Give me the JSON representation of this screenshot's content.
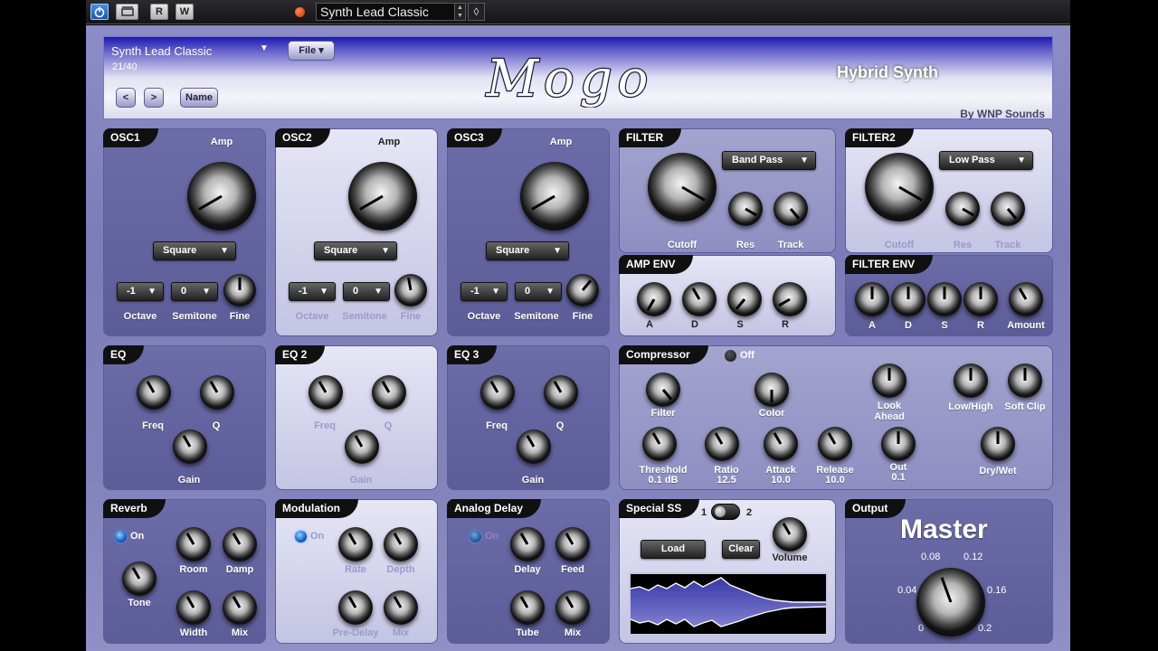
{
  "host": {
    "power_icon": "power-icon",
    "buttons": [
      "R",
      "W"
    ],
    "preset_name": "Synth Lead Classic"
  },
  "header": {
    "preset_name": "Synth Lead Classic",
    "preset_dropdown_icon": "triangle-down-icon",
    "preset_index": "21/40",
    "file_label": "File ▾",
    "prev_label": "<",
    "next_label": ">",
    "name_label": "Name",
    "logo": "Mogo",
    "subtitle": "Hybrid Synth",
    "byline": "By WNP Sounds"
  },
  "osc": [
    {
      "title": "OSC1",
      "amp": "Amp",
      "wave": "Square",
      "octave": "-1",
      "semitone": "0",
      "octave_label": "Octave",
      "semitone_label": "Semitone",
      "fine_label": "Fine"
    },
    {
      "title": "OSC2",
      "amp": "Amp",
      "wave": "Square",
      "octave": "-1",
      "semitone": "0",
      "octave_label": "Octave",
      "semitone_label": "Semitone",
      "fine_label": "Fine"
    },
    {
      "title": "OSC3",
      "amp": "Amp",
      "wave": "Square",
      "octave": "-1",
      "semitone": "0",
      "octave_label": "Octave",
      "semitone_label": "Semitone",
      "fine_label": "Fine"
    }
  ],
  "filter": {
    "title": "FILTER",
    "type": "Band Pass",
    "cutoff": "Cutoff",
    "res": "Res",
    "track": "Track"
  },
  "filter2": {
    "title": "FILTER2",
    "type": "Low Pass",
    "cutoff": "Cutoff",
    "res": "Res",
    "track": "Track"
  },
  "amp_env": {
    "title": "AMP ENV",
    "labels": [
      "A",
      "D",
      "S",
      "R"
    ]
  },
  "filter_env": {
    "title": "FILTER ENV",
    "labels": [
      "A",
      "D",
      "S",
      "R",
      "Amount"
    ]
  },
  "eq": [
    {
      "title": "EQ",
      "freq": "Freq",
      "q": "Q",
      "gain": "Gain"
    },
    {
      "title": "EQ 2",
      "freq": "Freq",
      "q": "Q",
      "gain": "Gain"
    },
    {
      "title": "EQ 3",
      "freq": "Freq",
      "q": "Q",
      "gain": "Gain"
    }
  ],
  "compressor": {
    "title": "Compressor",
    "state": "Off",
    "filter": "Filter",
    "color": "Color",
    "look_ahead": "Look\nAhead",
    "low_high": "Low/High",
    "soft_clip": "Soft Clip",
    "threshold": "Threshold",
    "threshold_val": "0.1 dB",
    "ratio": "Ratio",
    "ratio_val": "12.5",
    "attack": "Attack",
    "attack_val": "10.0",
    "release": "Release",
    "release_val": "10.0",
    "out": "Out",
    "out_val": "0.1",
    "dry_wet": "Dry/Wet"
  },
  "reverb": {
    "title": "Reverb",
    "state": "On",
    "room": "Room",
    "damp": "Damp",
    "tone": "Tone",
    "width": "Width",
    "mix": "Mix"
  },
  "modulation": {
    "title": "Modulation",
    "state": "On",
    "rate": "Rate",
    "depth": "Depth",
    "pre_delay": "Pre-Delay",
    "mix": "Mix"
  },
  "analog_delay": {
    "title": "Analog Delay",
    "state": "On",
    "delay": "Delay",
    "feed": "Feed",
    "tube": "Tube",
    "mix": "Mix"
  },
  "special": {
    "title": "Special SS",
    "opt1": "1",
    "opt2": "2",
    "load": "Load",
    "clear": "Clear",
    "volume": "Volume"
  },
  "output": {
    "title": "Output",
    "master": "Master",
    "ticks": [
      "0.08",
      "0.12",
      "0.04",
      "0.16",
      "0",
      "0.2"
    ]
  }
}
